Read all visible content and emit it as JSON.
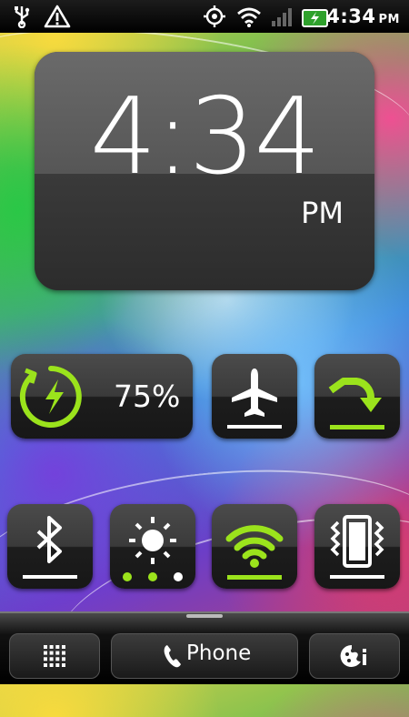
{
  "status_bar": {
    "time": "4:34",
    "ampm": "PM",
    "icons": [
      "usb-icon",
      "warning-icon",
      "gps-icon",
      "wifi-icon",
      "signal-icon",
      "battery-charging-icon"
    ]
  },
  "clock_widget": {
    "time": "4:34",
    "ampm": "PM"
  },
  "toggles": {
    "battery": {
      "percent": "75%",
      "icon": "battery-charging-icon",
      "accent": "#9be31c"
    },
    "airplane": {
      "icon": "airplane-icon",
      "state": "off"
    },
    "auto_rotate": {
      "icon": "rotate-icon",
      "state": "on"
    },
    "bluetooth": {
      "icon": "bluetooth-icon",
      "state": "off"
    },
    "brightness": {
      "icon": "brightness-icon",
      "level": 2,
      "levels": 3
    },
    "wifi": {
      "icon": "wifi-icon",
      "state": "on"
    },
    "vibrate": {
      "icon": "vibrate-icon",
      "state": "off"
    }
  },
  "dock": {
    "apps_icon": "app-grid-icon",
    "phone_label": "Phone",
    "personalize_icon": "personalize-icon"
  },
  "colors": {
    "accent_green": "#9be31c",
    "white": "#ffffff"
  }
}
